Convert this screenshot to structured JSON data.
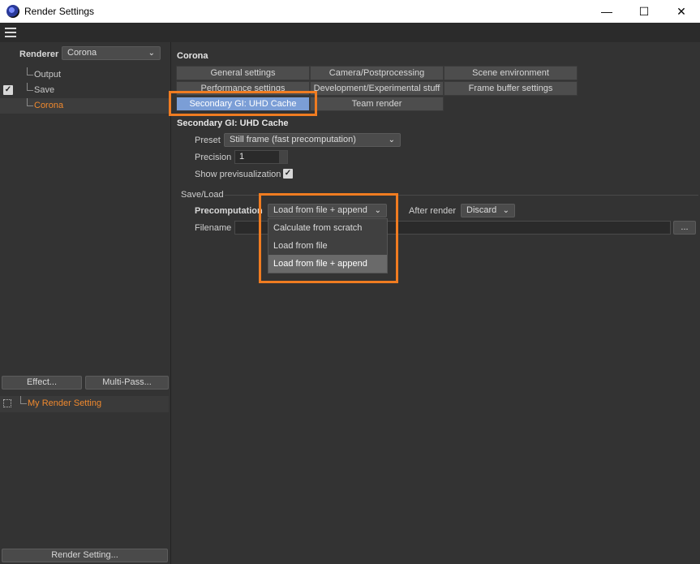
{
  "window": {
    "title": "Render Settings",
    "minimize_glyph": "—",
    "maximize_glyph": "☐",
    "close_glyph": "✕"
  },
  "left_panel": {
    "renderer_label": "Renderer",
    "renderer_value": "Corona",
    "tree": [
      {
        "label": "Output",
        "checked": false
      },
      {
        "label": "Save",
        "checked": true
      },
      {
        "label": "Corona",
        "checked": false,
        "selected": true
      }
    ],
    "effect_button": "Effect...",
    "multipass_button": "Multi-Pass...",
    "render_setting_item": "My Render Setting",
    "render_setting_button": "Render Setting..."
  },
  "right_panel": {
    "section_title": "Corona",
    "tabs_row1": [
      "General settings",
      "Camera/Postprocessing",
      "Scene environment"
    ],
    "tabs_row2": [
      "Performance settings",
      "Development/Experimental stuff",
      "Frame buffer settings"
    ],
    "tabs_row3": [
      "Secondary GI: UHD Cache",
      "Team render"
    ],
    "active_tab": "Secondary GI: UHD Cache",
    "subsection_title": "Secondary GI: UHD Cache",
    "preset_label": "Preset",
    "preset_value": "Still frame (fast precomputation)",
    "precision_label": "Precision",
    "precision_value": "1",
    "show_prev_label": "Show previsualization",
    "show_prev_checked": true,
    "saveload_label": "Save/Load",
    "precomputation_label": "Precomputation",
    "precomputation_value": "Load from file + append",
    "after_render_label": "After render",
    "after_render_value": "Discard",
    "filename_label": "Filename",
    "filename_value": "",
    "browse_button": "...",
    "dropdown_options": [
      "Calculate from scratch",
      "Load from file",
      "Load from file + append"
    ],
    "dropdown_selected": "Load from file + append"
  },
  "colors": {
    "accent": "#f0892e",
    "highlight_box": "#f07c21",
    "active_tab": "#7b9ed6"
  }
}
